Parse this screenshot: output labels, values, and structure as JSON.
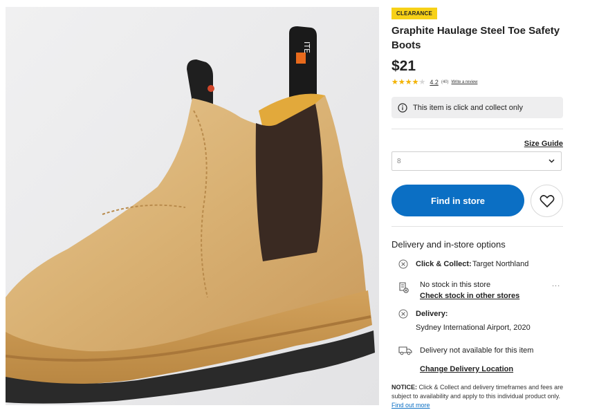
{
  "product": {
    "badge": "CLEARANCE",
    "title": "Graphite Haulage Steel Toe Safety Boots",
    "price": "$21",
    "rating": {
      "score": "4.2",
      "count": "(40)",
      "write_review": "Write a review",
      "stars_value": 4.2,
      "stars_max": 5
    },
    "click_collect_notice": "This item is click and collect only",
    "size_guide": "Size Guide",
    "size_selected": "8",
    "find_in_store": "Find in store",
    "image_brand_text": "ITE"
  },
  "delivery": {
    "heading": "Delivery and in-store options",
    "click_collect_label": "Click & Collect:",
    "click_collect_store": "Target Northland",
    "stock_status": "No stock in this store",
    "check_stock_link": "Check stock in other stores",
    "delivery_label": "Delivery:",
    "delivery_location": "Sydney International Airport, 2020",
    "delivery_status": "Delivery not available for this item",
    "change_location_link": "Change Delivery Location",
    "more_options": "..."
  },
  "notice": {
    "label": "NOTICE:",
    "text": "Click & Collect and delivery timeframes and fees are subject to availability and apply to this individual product only.",
    "link": "Find out more"
  },
  "colors": {
    "accent": "#0b6fc4",
    "badge": "#f7d117",
    "star": "#f5b400"
  }
}
